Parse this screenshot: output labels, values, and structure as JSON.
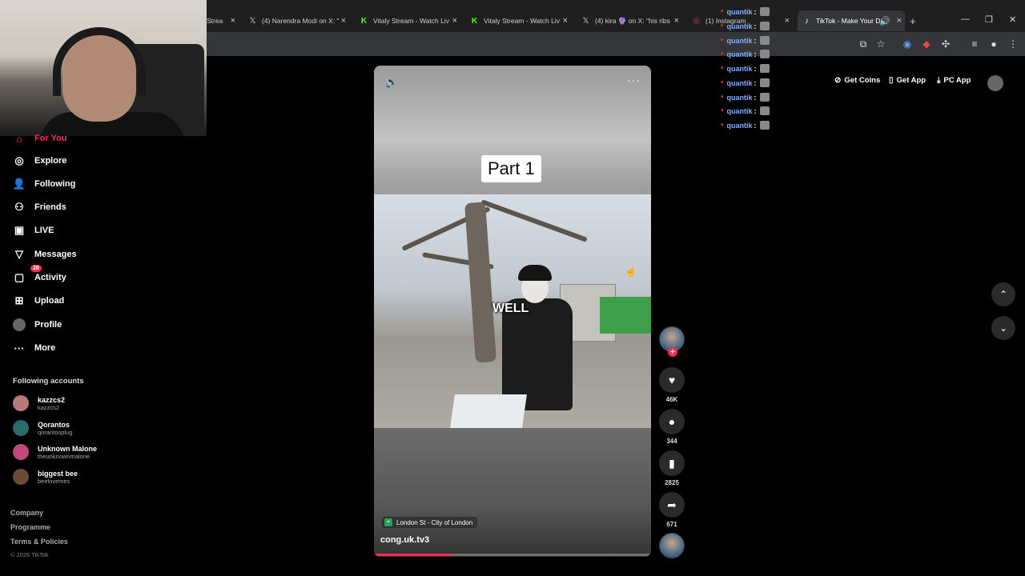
{
  "browser": {
    "tabs": [
      {
        "title": "Strea",
        "icon": "tab-icon"
      },
      {
        "title": "(4) Narendra Modi on X: \"",
        "icon": "x-icon"
      },
      {
        "title": "Vitaly Stream - Watch Liv",
        "icon": "kick-icon"
      },
      {
        "title": "Vitaly Stream - Watch Liv",
        "icon": "kick-icon"
      },
      {
        "title": "(4) kira 🔮 on X: \"his ribs",
        "icon": "x-icon"
      },
      {
        "title": "(1) Instagram",
        "icon": "instagram-icon"
      },
      {
        "title": "TikTok - Make Your Da",
        "icon": "tiktok-icon"
      }
    ],
    "new_tab_label": "+"
  },
  "sidebar": {
    "nav": [
      {
        "label": "For You",
        "icon": "home-icon"
      },
      {
        "label": "Explore",
        "icon": "compass-icon"
      },
      {
        "label": "Following",
        "icon": "following-icon"
      },
      {
        "label": "Friends",
        "icon": "friends-icon"
      },
      {
        "label": "LIVE",
        "icon": "live-icon"
      },
      {
        "label": "Messages",
        "icon": "messages-icon"
      },
      {
        "label": "Activity",
        "icon": "activity-icon",
        "badge": "28"
      },
      {
        "label": "Upload",
        "icon": "upload-icon"
      },
      {
        "label": "Profile",
        "icon": "profile-icon"
      },
      {
        "label": "More",
        "icon": "more-icon"
      }
    ],
    "following_title": "Following accounts",
    "accounts": [
      {
        "name": "kazzcs2",
        "handle": "kazzcs2"
      },
      {
        "name": "Qorantos",
        "handle": "qorantosplug"
      },
      {
        "name": "Unknown Malone",
        "handle": "theunknownmalone"
      },
      {
        "name": "biggest bee",
        "handle": "beelovemes"
      }
    ],
    "footer_links": [
      "Company",
      "Programme",
      "Terms & Policies"
    ],
    "copyright": "© 2026 TikTok"
  },
  "header": {
    "get_coins": "Get Coins",
    "get_app": "Get App",
    "pc_app": "PC App"
  },
  "video": {
    "overlay_title": "Part 1",
    "caption": "WELL",
    "location": "London St - City of London",
    "author": "cong.uk.tv3",
    "progress": 0.28
  },
  "actions": {
    "likes": "46K",
    "comments": "344",
    "saves": "2825",
    "shares": "671"
  },
  "chat": {
    "lines": [
      {
        "user": "quantik"
      },
      {
        "user": "quantik"
      },
      {
        "user": "quantik"
      },
      {
        "user": "quantik"
      },
      {
        "user": "quantik"
      },
      {
        "user": "quantik"
      },
      {
        "user": "quantik"
      },
      {
        "user": "quantik"
      },
      {
        "user": "quantik"
      }
    ],
    "separator": ":"
  },
  "colors": {
    "accent": "#fe2c55",
    "chat_user": "#7fb0ff"
  }
}
